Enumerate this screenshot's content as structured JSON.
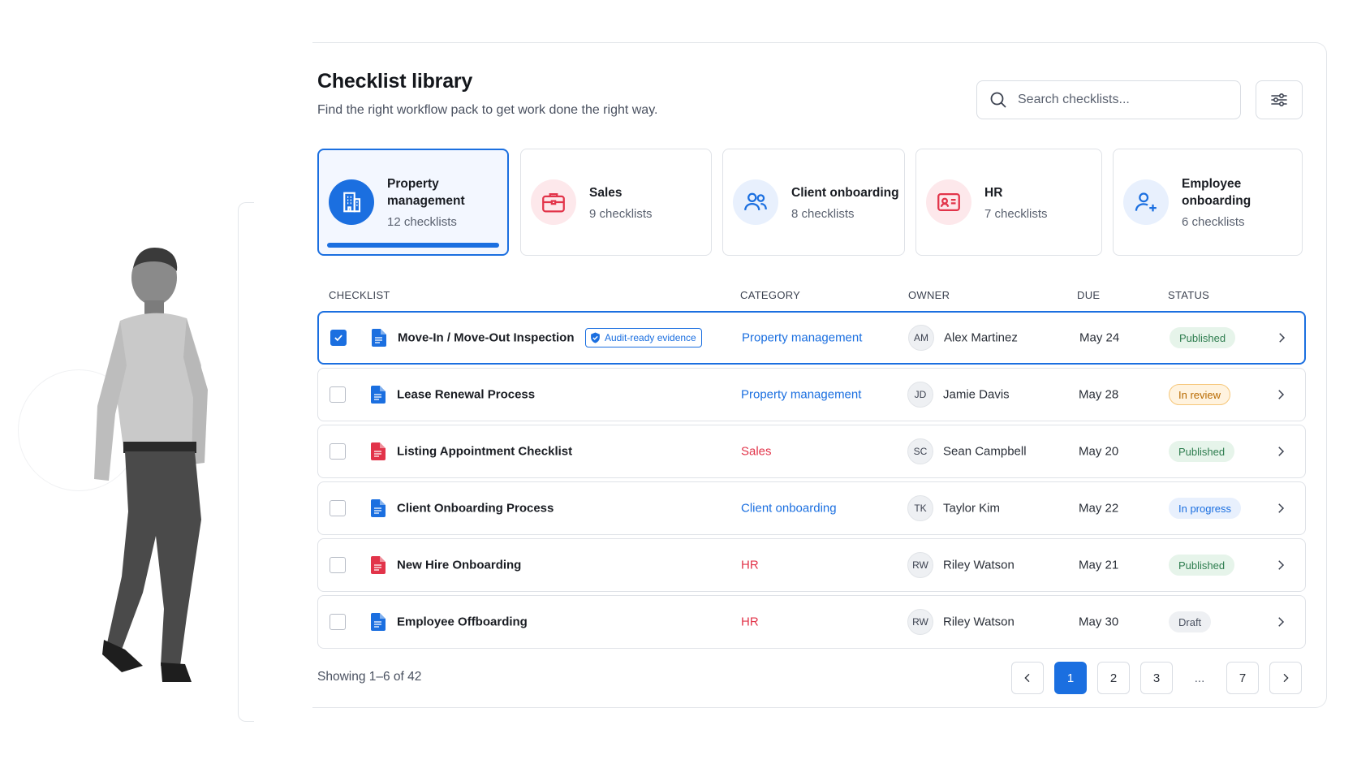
{
  "header": {
    "title": "Checklist library",
    "subtitle": "Find the right workflow pack to get work done the right way."
  },
  "search": {
    "placeholder": "Search checklists...",
    "value": ""
  },
  "categories": [
    {
      "name": "Property management",
      "count": "12 checklists",
      "icon": "building-icon",
      "color": "#1b6fe0",
      "active": true
    },
    {
      "name": "Sales",
      "count": "9 checklists",
      "icon": "briefcase-icon",
      "color": "#e2344a",
      "active": false
    },
    {
      "name": "Client onboarding",
      "count": "8 checklists",
      "icon": "users-icon",
      "color": "#1b6fe0",
      "active": false
    },
    {
      "name": "HR",
      "count": "7 checklists",
      "icon": "id-card-icon",
      "color": "#e2344a",
      "active": false
    },
    {
      "name": "Employee onboarding",
      "count": "6 checklists",
      "icon": "user-plus-icon",
      "color": "#1b6fe0",
      "active": false
    }
  ],
  "table": {
    "columns": [
      "CHECKLIST",
      "CATEGORY",
      "OWNER",
      "DUE",
      "STATUS"
    ],
    "rows": [
      {
        "name": "Move-In / Move-Out Inspection",
        "badge": "Audit-ready evidence",
        "category": "Property management",
        "category_color": "#1b6fe0",
        "doc_color": "#1b6fe0",
        "initials": "AM",
        "owner": "Alex Martinez",
        "due": "May 24",
        "status": "Published",
        "status_type": "published",
        "selected": true
      },
      {
        "name": "Lease Renewal Process",
        "badge": "",
        "category": "Property management",
        "category_color": "#1b6fe0",
        "doc_color": "#1b6fe0",
        "initials": "JD",
        "owner": "Jamie Davis",
        "due": "May 28",
        "status": "In review",
        "status_type": "review",
        "selected": false
      },
      {
        "name": "Listing Appointment Checklist",
        "badge": "",
        "category": "Sales",
        "category_color": "#e2344a",
        "doc_color": "#e2344a",
        "initials": "SC",
        "owner": "Sean Campbell",
        "due": "May 20",
        "status": "Published",
        "status_type": "published",
        "selected": false
      },
      {
        "name": "Client Onboarding Process",
        "badge": "",
        "category": "Client onboarding",
        "category_color": "#1b6fe0",
        "doc_color": "#1b6fe0",
        "initials": "TK",
        "owner": "Taylor Kim",
        "due": "May 22",
        "status": "In progress",
        "status_type": "progress",
        "selected": false
      },
      {
        "name": "New Hire Onboarding",
        "badge": "",
        "category": "HR",
        "category_color": "#e2344a",
        "doc_color": "#e2344a",
        "initials": "RW",
        "owner": "Riley Watson",
        "due": "May 21",
        "status": "Published",
        "status_type": "published",
        "selected": false
      },
      {
        "name": "Employee Offboarding",
        "badge": "",
        "category": "HR",
        "category_color": "#e2344a",
        "doc_color": "#1b6fe0",
        "initials": "RW",
        "owner": "Riley Watson",
        "due": "May 30",
        "status": "Draft",
        "status_type": "draft",
        "selected": false
      }
    ]
  },
  "status_styles": {
    "published": {
      "bg": "#e6f4ea",
      "fg": "#2e7d4f",
      "border": "#e6f4ea"
    },
    "review": {
      "bg": "#fff3df",
      "fg": "#b86a00",
      "border": "#f6c77a"
    },
    "progress": {
      "bg": "#e8f0fd",
      "fg": "#1b6fe0",
      "border": "#e8f0fd"
    },
    "draft": {
      "bg": "#eef0f3",
      "fg": "#4a5160",
      "border": "#eef0f3"
    }
  },
  "footer": {
    "showing": "Showing 1–6 of 42",
    "pages": [
      "1",
      "2",
      "3",
      "...",
      "7"
    ],
    "current_page": "1"
  }
}
